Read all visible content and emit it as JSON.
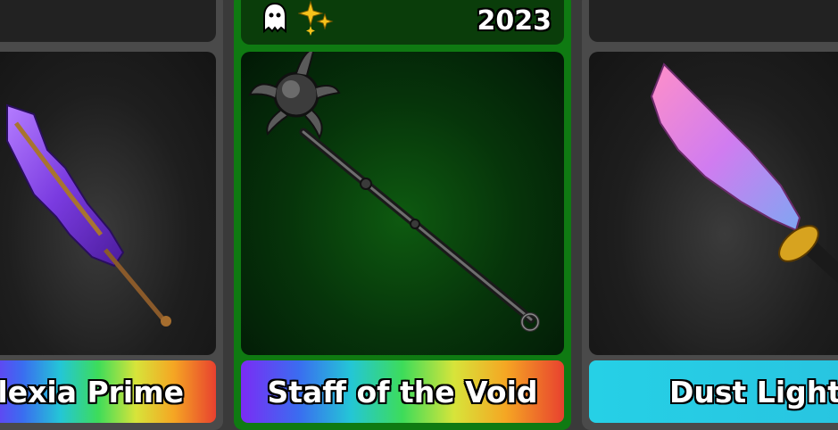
{
  "cards": [
    {
      "name": "plexia Prime",
      "style": "rainbow"
    },
    {
      "name": "Staff of the Void",
      "style": "rainbow",
      "year": "2023",
      "badges": [
        "ghost-icon",
        "sparkle-icon"
      ]
    },
    {
      "name": "Dust Light",
      "style": "cyan"
    }
  ],
  "colors": {
    "chroma_bar": "rainbow",
    "selected_card": "#0f7a12",
    "cyan_bar": "#26d0e6"
  }
}
